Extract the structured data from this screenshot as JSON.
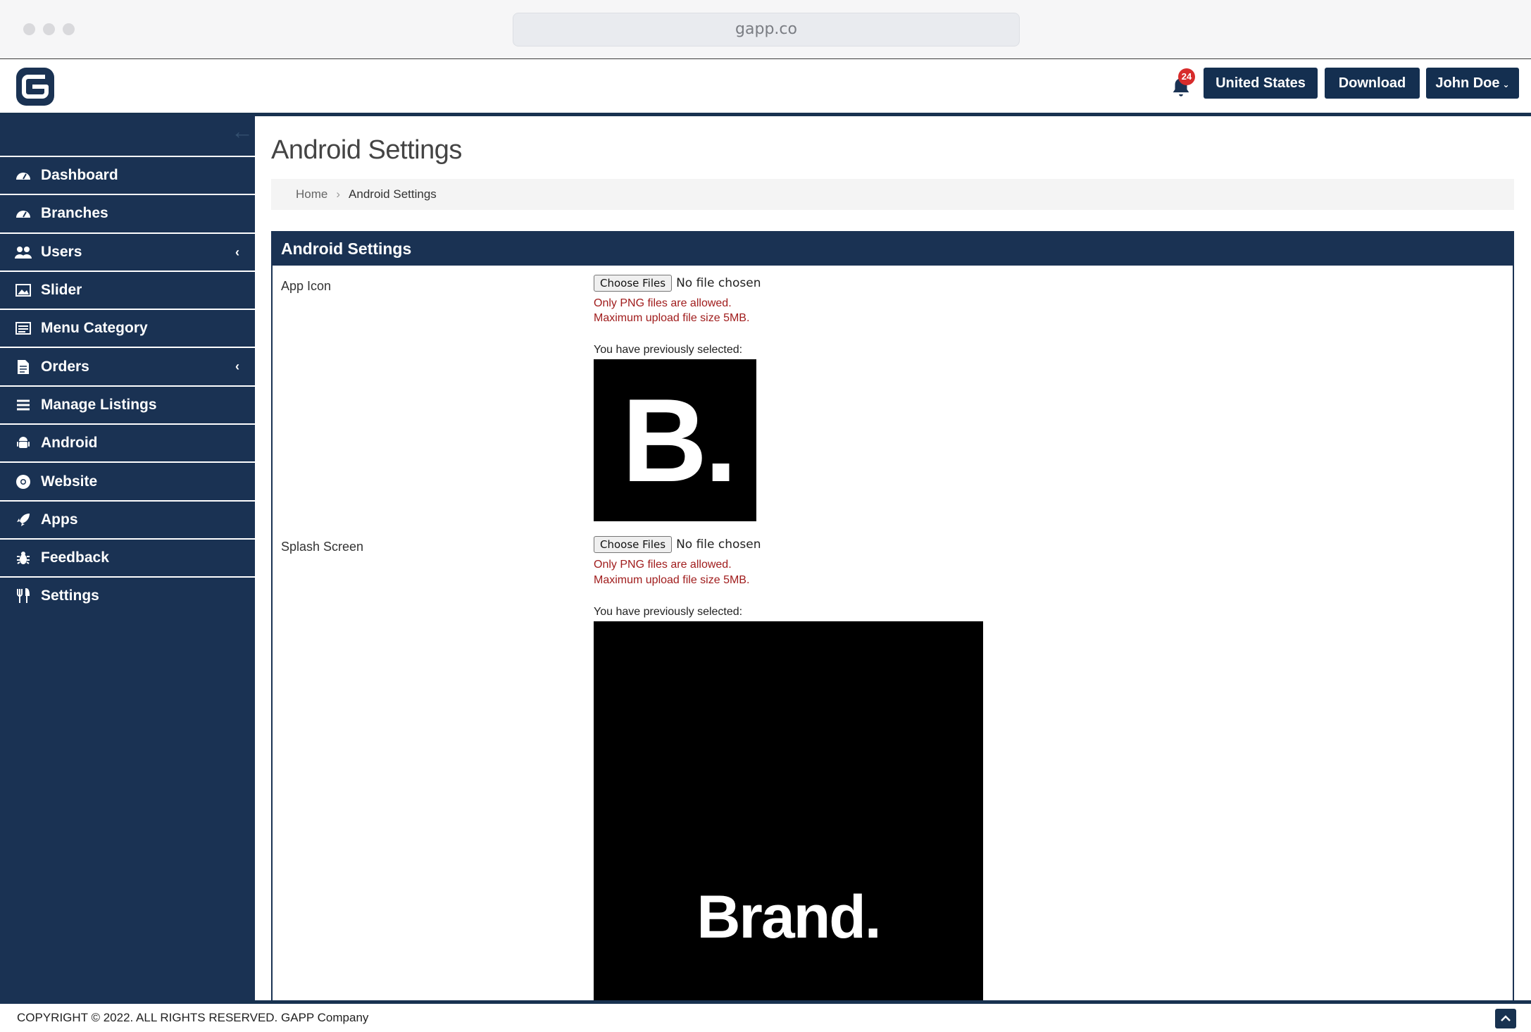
{
  "browser": {
    "url": "gapp.co"
  },
  "header": {
    "notification_count": "24",
    "country_button": "United States",
    "download_button": "Download",
    "user_button": "John Doe"
  },
  "sidebar": {
    "items": [
      {
        "label": "Dashboard",
        "icon": "dashboard-icon"
      },
      {
        "label": "Branches",
        "icon": "dashboard-icon"
      },
      {
        "label": "Users",
        "icon": "users-icon"
      },
      {
        "label": "Slider",
        "icon": "image-icon"
      },
      {
        "label": "Menu Category",
        "icon": "list-box-icon"
      },
      {
        "label": "Orders",
        "icon": "document-icon"
      },
      {
        "label": "Manage Listings",
        "icon": "bars-icon"
      },
      {
        "label": "Android",
        "icon": "android-icon"
      },
      {
        "label": "Website",
        "icon": "chrome-icon"
      },
      {
        "label": "Apps",
        "icon": "rocket-icon"
      },
      {
        "label": "Feedback",
        "icon": "bug-icon"
      },
      {
        "label": "Settings",
        "icon": "utensils-icon"
      }
    ]
  },
  "page": {
    "title": "Android Settings",
    "breadcrumb": {
      "home": "Home",
      "current": "Android Settings"
    }
  },
  "panel": {
    "title": "Android Settings",
    "app_icon": {
      "label": "App Icon",
      "button": "Choose Files",
      "status": "No file chosen",
      "warning_1": "Only PNG files are allowed.",
      "warning_2": "Maximum upload file size 5MB.",
      "previous": "You have previously selected:",
      "image_text": "B."
    },
    "splash_screen": {
      "label": "Splash Screen",
      "button": "Choose Files",
      "status": "No file chosen",
      "warning_1": "Only PNG files are allowed.",
      "warning_2": "Maximum upload file size 5MB.",
      "previous": "You have previously selected:",
      "image_text": "Brand."
    }
  },
  "footer": {
    "copyright": "COPYRIGHT © 2022. ALL RIGHTS RESERVED. GAPP Company"
  },
  "colors": {
    "navy": "#1a3253",
    "badge": "#d72c2c",
    "warning": "#a01c1c"
  }
}
